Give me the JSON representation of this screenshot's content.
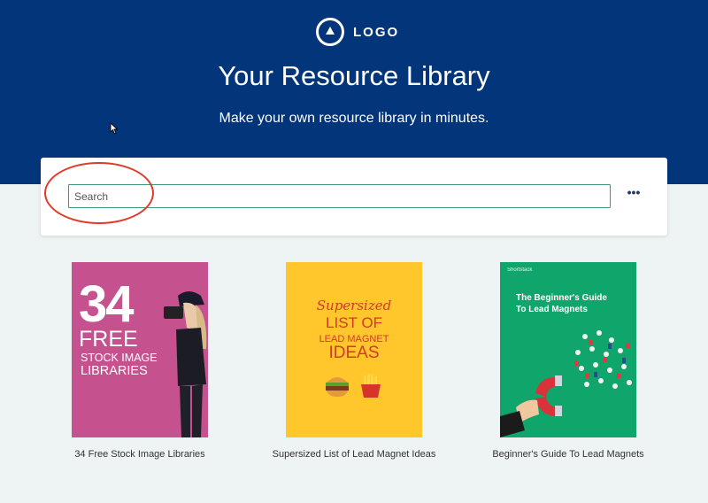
{
  "header": {
    "logo_text": "LOGO",
    "title": "Your Resource Library",
    "subtitle": "Make your own resource library in minutes."
  },
  "search": {
    "placeholder": "Search",
    "value": "",
    "more_label": "•••"
  },
  "resources": [
    {
      "caption": "34 Free Stock Image Libraries",
      "cover": {
        "number": "34",
        "line1": "FREE",
        "line2": "STOCK IMAGE",
        "line3": "LIBRARIES"
      }
    },
    {
      "caption": "Supersized List of Lead Magnet Ideas",
      "cover": {
        "line1": "Supersized",
        "line2": "LIST OF",
        "line3": "LEAD MAGNET",
        "line4": "IDEAS"
      }
    },
    {
      "caption": "Beginner's Guide To Lead Magnets",
      "cover": {
        "brand": "Shortstack",
        "line1": "The Beginner's Guide",
        "line2": "To Lead Magnets"
      }
    }
  ],
  "colors": {
    "hero_bg": "#02357a",
    "page_bg": "#eef3f3",
    "input_border": "#3e9b75",
    "annotation": "#e03a2a"
  },
  "icons": [
    "logo-triangle-icon",
    "mouse-cursor-icon",
    "more-options-icon"
  ]
}
